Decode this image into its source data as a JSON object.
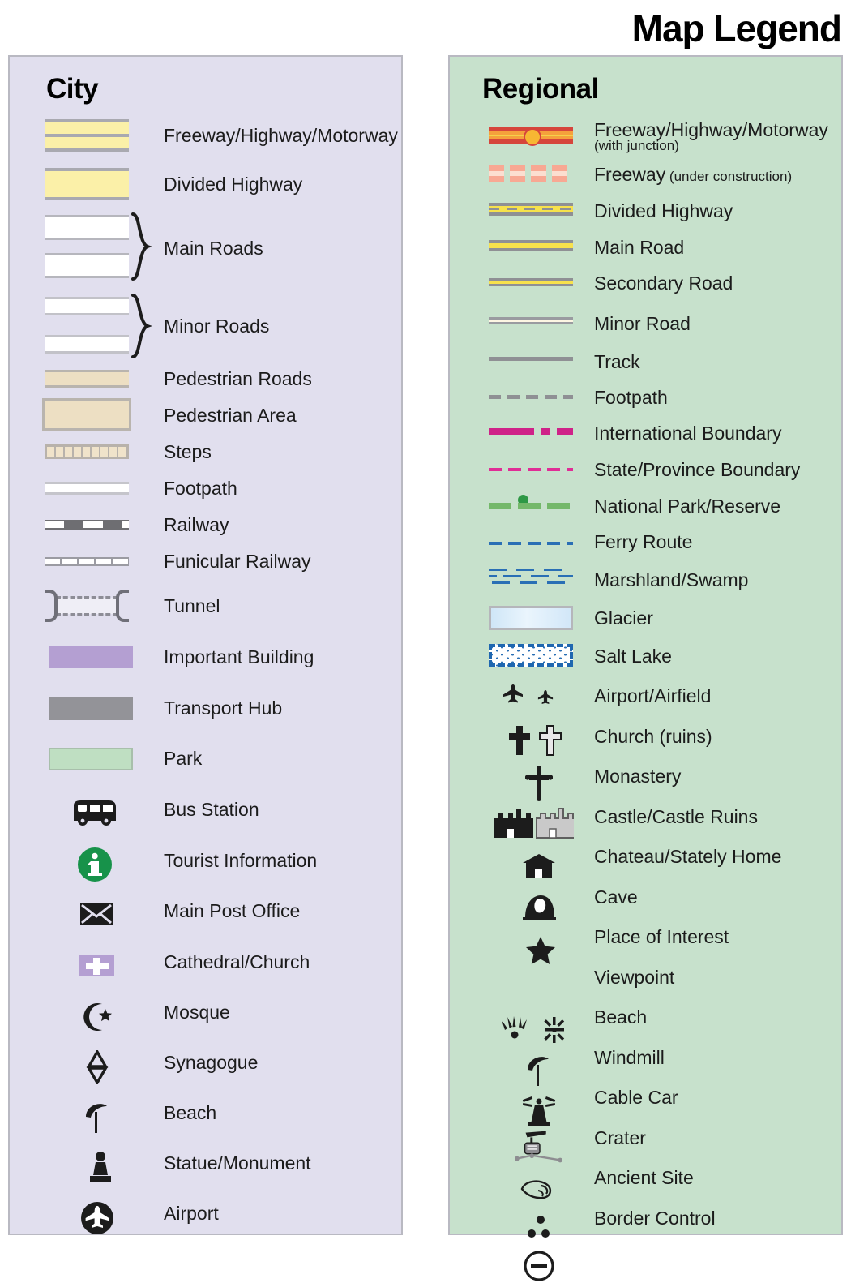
{
  "title": "Map Legend",
  "panels": {
    "city": {
      "heading": "City",
      "background": "#e1dfee",
      "items": [
        {
          "label": "Freeway/Highway/Motorway",
          "symbol": "freeway-city-swatch"
        },
        {
          "label": "Divided Highway",
          "symbol": "divided-highway-city-swatch"
        },
        {
          "label": "Main Roads",
          "symbol": "main-roads-city-swatch"
        },
        {
          "label": "Minor Roads",
          "symbol": "minor-roads-city-swatch"
        },
        {
          "label": "Pedestrian Roads",
          "symbol": "pedestrian-road-swatch"
        },
        {
          "label": "Pedestrian Area",
          "symbol": "pedestrian-area-swatch"
        },
        {
          "label": "Steps",
          "symbol": "steps-swatch"
        },
        {
          "label": "Footpath",
          "symbol": "footpath-city-swatch"
        },
        {
          "label": "Railway",
          "symbol": "railway-city-swatch"
        },
        {
          "label": "Funicular Railway",
          "symbol": "funicular-railway-swatch"
        },
        {
          "label": "Tunnel",
          "symbol": "tunnel-swatch"
        },
        {
          "label": "Important Building",
          "symbol": "important-building-swatch"
        },
        {
          "label": "Transport Hub",
          "symbol": "transport-hub-swatch"
        },
        {
          "label": "Park",
          "symbol": "park-swatch"
        },
        {
          "label": "Bus Station",
          "symbol": "bus-icon"
        },
        {
          "label": "Tourist Information",
          "symbol": "information-icon"
        },
        {
          "label": "Main Post Office",
          "symbol": "envelope-icon"
        },
        {
          "label": "Cathedral/Church",
          "symbol": "church-cross-icon"
        },
        {
          "label": "Mosque",
          "symbol": "crescent-star-icon"
        },
        {
          "label": "Synagogue",
          "symbol": "star-of-david-icon"
        },
        {
          "label": "Beach",
          "symbol": "beach-umbrella-icon"
        },
        {
          "label": "Statue/Monument",
          "symbol": "statue-icon"
        },
        {
          "label": "Airport",
          "symbol": "airplane-circle-icon"
        }
      ],
      "colors": {
        "freeway_fill": "#fbf0a8",
        "pedestrian_fill": "#eddfc3",
        "important_building": "#b49fd2",
        "transport_hub": "#939398",
        "park": "#bfdfc2",
        "tourist_info": "#17924a"
      }
    },
    "regional": {
      "heading": "Regional",
      "background": "#c7e1cc",
      "items": [
        {
          "label": "Freeway/Highway/Motorway",
          "sublabel": "(with junction)",
          "sub_block": true,
          "symbol": "freeway-junction-line"
        },
        {
          "label": "Freeway",
          "sublabel": " (under construction)",
          "symbol": "freeway-under-construction-line"
        },
        {
          "label": "Divided Highway",
          "symbol": "divided-highway-line"
        },
        {
          "label": "Main Road",
          "symbol": "main-road-line"
        },
        {
          "label": "Secondary Road",
          "symbol": "secondary-road-line"
        },
        {
          "label": "Minor Road",
          "symbol": "minor-road-line"
        },
        {
          "label": "Track",
          "symbol": "track-line"
        },
        {
          "label": "Footpath",
          "symbol": "footpath-line"
        },
        {
          "label": "International Boundary",
          "symbol": "international-boundary-line"
        },
        {
          "label": "State/Province Boundary",
          "symbol": "state-boundary-line"
        },
        {
          "label": "National Park/Reserve",
          "symbol": "national-park-line"
        },
        {
          "label": "Ferry Route",
          "symbol": "ferry-route-line"
        },
        {
          "label": "Marshland/Swamp",
          "symbol": "marshland-pattern"
        },
        {
          "label": "Glacier",
          "symbol": "glacier-swatch"
        },
        {
          "label": "Salt Lake",
          "symbol": "salt-lake-swatch"
        },
        {
          "label": "Airport/Airfield",
          "symbol": "airplane-icon"
        },
        {
          "label": "Church (ruins)",
          "symbol": "cross-icon"
        },
        {
          "label": "Monastery",
          "symbol": "orthodox-cross-icon"
        },
        {
          "label": "Castle/Castle Ruins",
          "symbol": "castle-icon"
        },
        {
          "label": "Chateau/Stately Home",
          "symbol": "chateau-icon"
        },
        {
          "label": "Cave",
          "symbol": "cave-icon"
        },
        {
          "label": "Place of Interest",
          "symbol": "star-icon"
        },
        {
          "label": "Viewpoint",
          "symbol": "viewpoint-icon"
        },
        {
          "label": "Beach",
          "symbol": "beach-umbrella-icon"
        },
        {
          "label": "Windmill",
          "symbol": "windmill-icon"
        },
        {
          "label": "Cable Car",
          "symbol": "cable-car-icon"
        },
        {
          "label": "Crater",
          "symbol": "crater-icon"
        },
        {
          "label": "Ancient Site",
          "symbol": "ancient-site-icon"
        },
        {
          "label": "Border Control",
          "symbol": "border-control-icon"
        }
      ],
      "colors": {
        "freeway_casing": "#d6453c",
        "freeway_fill": "#f5a13c",
        "junction": "#f7b733",
        "under_construction": "#f8a893",
        "road_casing": "#8f9094",
        "road_fill": "#f7e14c",
        "international_boundary": "#cf2288",
        "state_boundary": "#e02d96",
        "national_park": "#74b86a",
        "park_dot": "#2e9845",
        "water": "#2a6fb5",
        "glacier": "#cfe6f7"
      }
    }
  }
}
